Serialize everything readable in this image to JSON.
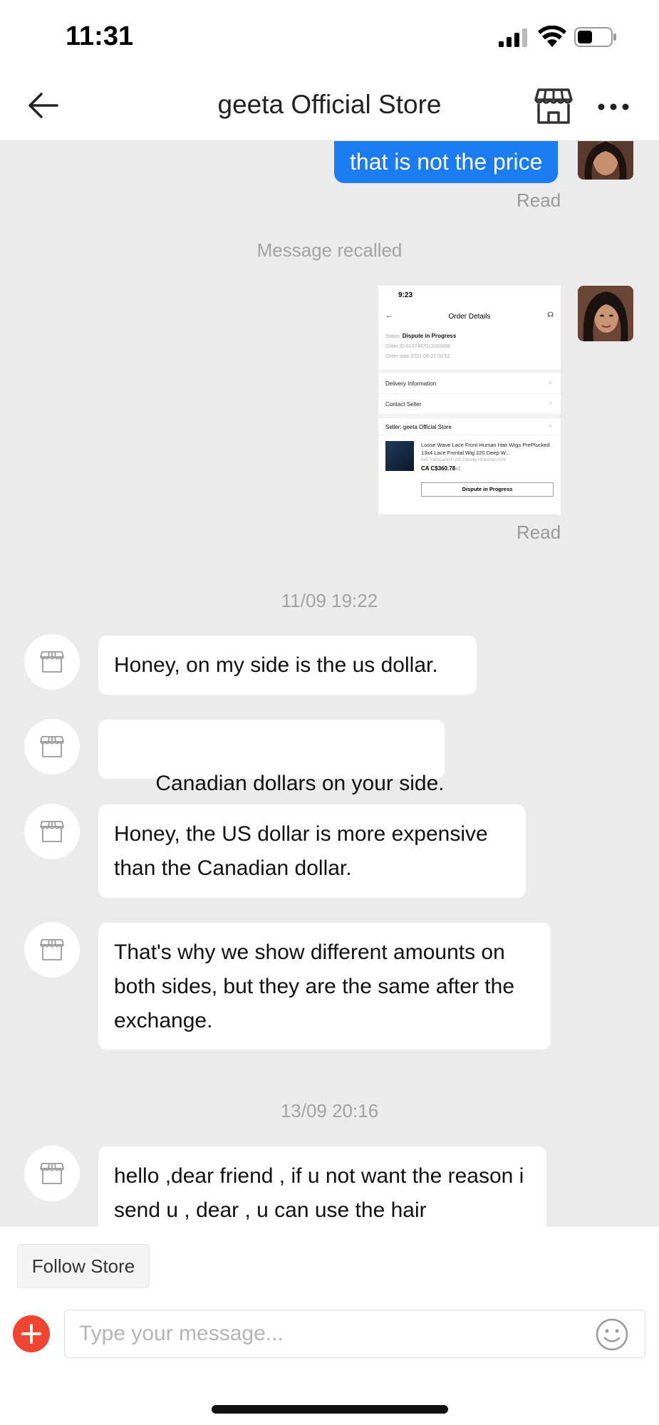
{
  "status_bar": {
    "time": "11:31"
  },
  "header": {
    "title": "geeta Official Store"
  },
  "chat": {
    "outgoing_text": "that is not the price",
    "read_label_1": "Read",
    "recalled": "Message recalled",
    "read_label_2": "Read",
    "timestamp_1": "11/09 19:22",
    "messages_1": [
      "Honey, on my side is the us dollar.",
      " Canadian dollars on your side.",
      "Honey, the US dollar is more expensive than the Canadian dollar.",
      "That's why we show different amounts on both sides, but they are the same after the exchange."
    ],
    "timestamp_2": "13/09 20:16",
    "message_partial": "hello ,dear friend , if u not want the reason i send u , dear , u can use the hair"
  },
  "screenshot": {
    "time": "9:23",
    "title": "Order Details",
    "status_label": "Status:",
    "status_value": "Dispute in Progress",
    "order_id": "Order ID:8137407012060488",
    "order_date": "Order date:2021-08-22 03:52",
    "delivery": "Delivery Information",
    "contact": "Contact Seller",
    "seller": "Seller: geeta Official Store",
    "product_name": "Loose Wave Lace Front Human Hair Wigs PrePlucked 13x4 Lace Frontal Wig 220 Deep W...",
    "product_variant": "5x5 Transparent+220 Density+30inches+CN",
    "product_price": "CA C$360.78",
    "product_qty": "x1",
    "button": "Dispute in Progress"
  },
  "bottom": {
    "follow": "Follow Store",
    "input_placeholder": "Type your message..."
  },
  "colors": {
    "accent": "#1a7cf0",
    "add_button": "#f04531",
    "chat_bg": "#ebebeb"
  }
}
